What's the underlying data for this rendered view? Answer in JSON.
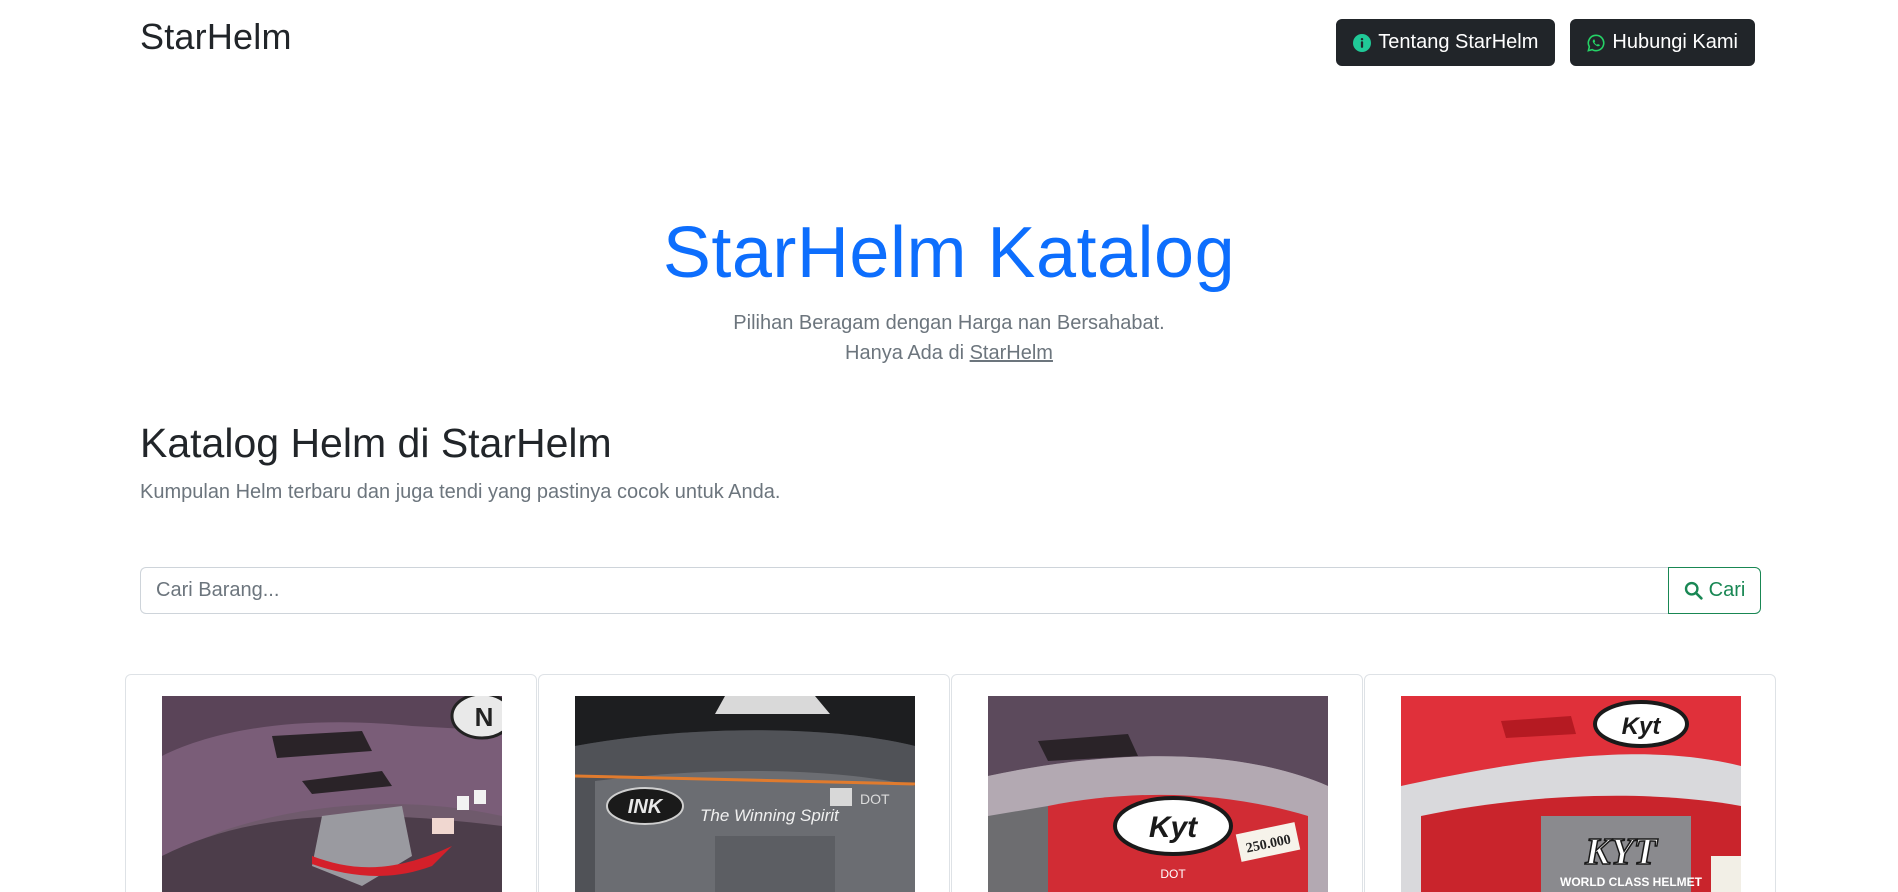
{
  "header": {
    "brand": "StarHelm",
    "about_button": "Tentang StarHelm",
    "contact_button": "Hubungi Kami"
  },
  "hero": {
    "title": "StarHelm Katalog",
    "subtitle_line1": "Pilihan Beragam dengan Harga nan Bersahabat.",
    "subtitle_line2_prefix": "Hanya Ada di",
    "subtitle_link": "StarHelm"
  },
  "catalog": {
    "title": "Katalog Helm di StarHelm",
    "description": "Kumpulan Helm terbaru dan juga tendi yang pastinya cocok untuk Anda."
  },
  "search": {
    "placeholder": "Cari Barang...",
    "value": "",
    "button_label": "Cari"
  },
  "products": [
    {
      "image_label": "purple helmet",
      "logo_text": "N"
    },
    {
      "image_label": "black helmet",
      "logo_text": "INK",
      "visor_text": "The Winning Spirit",
      "badge_text": "DOT"
    },
    {
      "image_label": "purple kyt helmet",
      "logo_text": "Kyt",
      "price_tag": "250.000",
      "badge_text": "DOT"
    },
    {
      "image_label": "red kyt helmet",
      "logo_text": "Kyt",
      "brand_text": "KYT",
      "tag_text": "WORLD CLASS HELMET"
    }
  ],
  "colors": {
    "primary": "#0d6efd",
    "dark": "#212529",
    "success": "#198754",
    "muted": "#6c757d",
    "info_icon": "#20c997",
    "whatsapp_icon": "#25d366"
  }
}
